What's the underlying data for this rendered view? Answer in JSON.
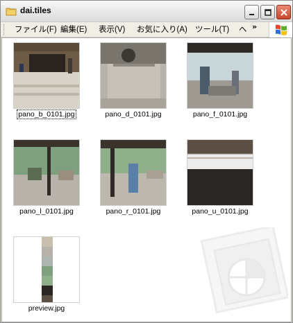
{
  "window": {
    "title": "dai.tiles",
    "title_icon": "folder-icon"
  },
  "menubar": {
    "items": [
      {
        "label": "ファイル(F)"
      },
      {
        "label": "編集(E)"
      },
      {
        "label": "表示(V)"
      },
      {
        "label": "お気に入り(A)"
      },
      {
        "label": "ツール(T)"
      },
      {
        "label": "ヘ"
      }
    ],
    "overflow_label": "»"
  },
  "files": [
    {
      "name": "pano_b_0101.jpg",
      "selected": true
    },
    {
      "name": "pano_d_0101.jpg",
      "selected": false
    },
    {
      "name": "pano_f_0101.jpg",
      "selected": false
    },
    {
      "name": "pano_l_0101.jpg",
      "selected": false
    },
    {
      "name": "pano_r_0101.jpg",
      "selected": false
    },
    {
      "name": "pano_u_0101.jpg",
      "selected": false
    },
    {
      "name": "preview.jpg",
      "selected": false
    }
  ],
  "colors": {
    "selection_outline": "#000000",
    "close_button": "#c7472c"
  }
}
